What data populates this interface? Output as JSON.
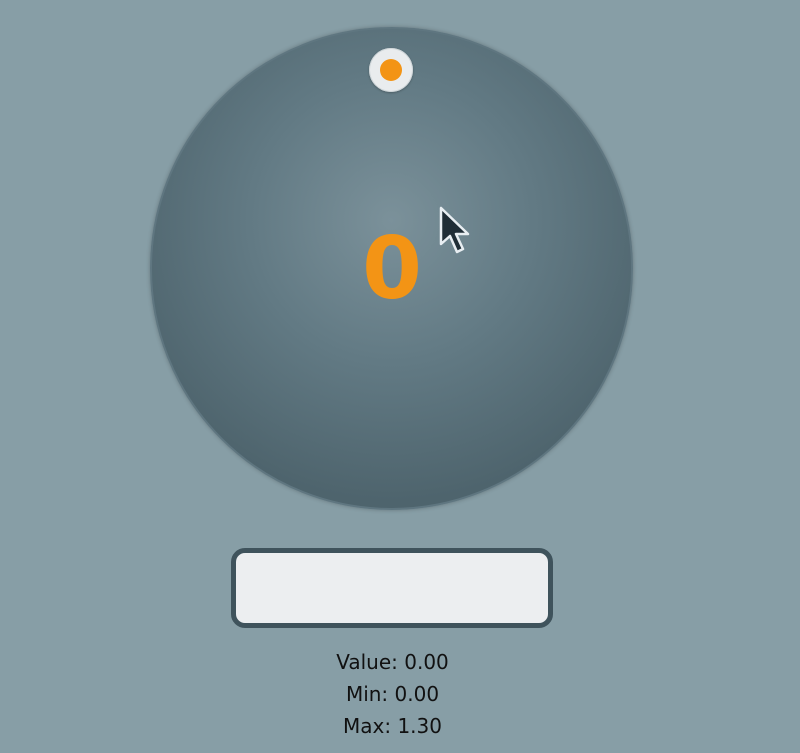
{
  "dial": {
    "display_value": "0",
    "accent_color": "#f39415",
    "knob_icon": "dial-knob-icon",
    "level": 0
  },
  "input": {
    "value": "",
    "placeholder": ""
  },
  "stats": {
    "value_text": "Value: 0.00",
    "min_text": "Min: 0.00",
    "max_text": "Max: 1.30"
  },
  "colors": {
    "background": "#879ea6",
    "dial": "#5a717a",
    "input_border": "#3f535c",
    "accent": "#f39415"
  },
  "cursor_icon": "mouse-pointer-icon"
}
